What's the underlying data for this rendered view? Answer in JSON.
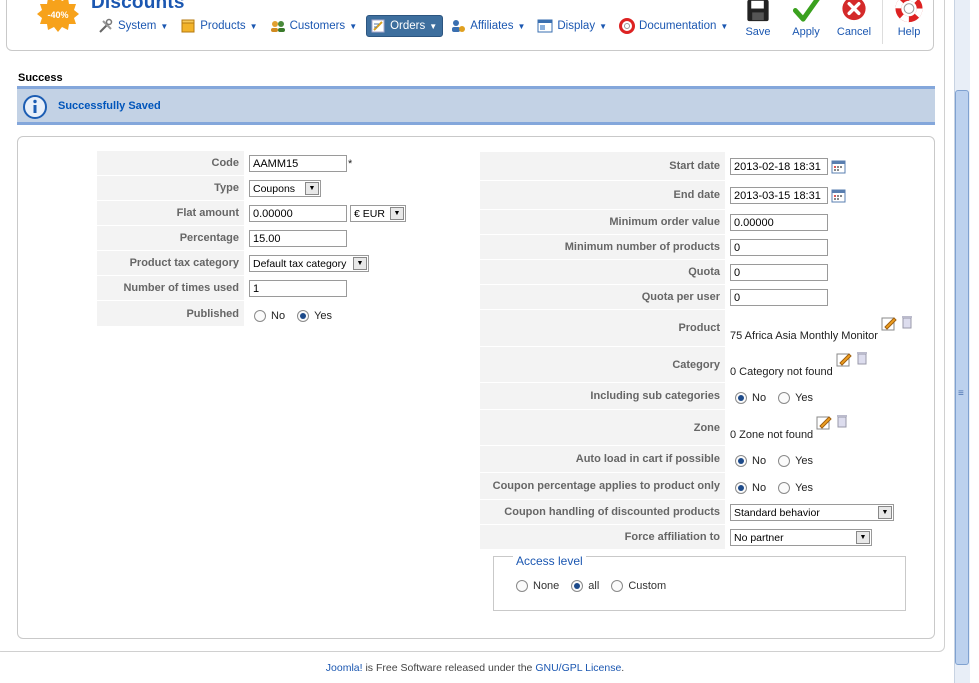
{
  "header": {
    "page_title": "Discounts",
    "logo_text": "-40%",
    "menu": [
      {
        "label": "System",
        "icon": "tools-icon",
        "active": false
      },
      {
        "label": "Products",
        "icon": "box-icon",
        "active": false
      },
      {
        "label": "Customers",
        "icon": "users-icon",
        "active": false
      },
      {
        "label": "Orders",
        "icon": "order-icon",
        "active": true
      },
      {
        "label": "Affiliates",
        "icon": "affiliate-icon",
        "active": false
      },
      {
        "label": "Display",
        "icon": "display-icon",
        "active": false
      },
      {
        "label": "Documentation",
        "icon": "lifebuoy-icon",
        "active": false
      }
    ],
    "toolbar": {
      "save": "Save",
      "apply": "Apply",
      "cancel": "Cancel",
      "help": "Help"
    }
  },
  "message": {
    "title": "Success",
    "text": "Successfully Saved"
  },
  "left_form": {
    "code": {
      "label": "Code",
      "value": "AAMM15",
      "required_mark": "*"
    },
    "type": {
      "label": "Type",
      "value": "Coupons"
    },
    "flat_amount": {
      "label": "Flat amount",
      "value": "0.00000",
      "currency": "€ EUR"
    },
    "percentage": {
      "label": "Percentage",
      "value": "15.00"
    },
    "product_tax_category": {
      "label": "Product tax category",
      "value": "Default tax category"
    },
    "times_used": {
      "label": "Number of times used",
      "value": "1"
    },
    "published": {
      "label": "Published",
      "no": "No",
      "yes": "Yes",
      "selected": "yes"
    }
  },
  "right_form": {
    "start_date": {
      "label": "Start date",
      "value": "2013-02-18 18:31"
    },
    "end_date": {
      "label": "End date",
      "value": "2013-03-15 18:31"
    },
    "min_order_value": {
      "label": "Minimum order value",
      "value": "0.00000"
    },
    "min_products": {
      "label": "Minimum number of products",
      "value": "0"
    },
    "quota": {
      "label": "Quota",
      "value": "0"
    },
    "quota_per_user": {
      "label": "Quota per user",
      "value": "0"
    },
    "product": {
      "label": "Product",
      "value": "75 Africa Asia Monthly Monitor"
    },
    "category": {
      "label": "Category",
      "value": "0 Category not found"
    },
    "sub_categories": {
      "label": "Including sub categories",
      "no": "No",
      "yes": "Yes",
      "selected": "no"
    },
    "zone": {
      "label": "Zone",
      "value": "0 Zone not found"
    },
    "auto_load": {
      "label": "Auto load in cart if possible",
      "no": "No",
      "yes": "Yes",
      "selected": "no"
    },
    "pct_applies": {
      "label": "Coupon percentage applies to product only",
      "no": "No",
      "yes": "Yes",
      "selected": "no"
    },
    "handling": {
      "label": "Coupon handling of discounted products",
      "value": "Standard behavior"
    },
    "force_affiliation": {
      "label": "Force affiliation to",
      "value": "No partner"
    }
  },
  "access_level": {
    "legend": "Access level",
    "none": "None",
    "all": "all",
    "custom": "Custom",
    "selected": "all"
  },
  "footer": {
    "link1": "Joomla!",
    "text": " is Free Software released under the ",
    "link2": "GNU/GPL License",
    "end": "."
  },
  "colors": {
    "accent": "#1b57b1",
    "message_bg": "#c3d2e5",
    "message_border": "#84a7db",
    "active_menu": "#3e6f9e"
  }
}
